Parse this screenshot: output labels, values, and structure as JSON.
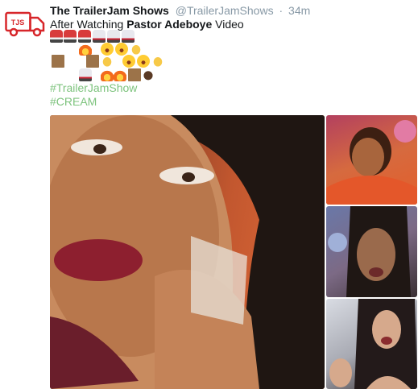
{
  "tweet": {
    "avatar_icon": "trailerjam-truck-logo-icon",
    "avatar_text": "TJS",
    "name": "The TrailerJam Shows",
    "handle": "@TrailerJamShows",
    "separator": "·",
    "time": "34m",
    "text_prefix": "After Watching",
    "text_bold": "Pastor Adeboye",
    "text_suffix": "Video",
    "emoji_rows": [
      [
        "bus-emoji",
        "bus-emoji",
        "bus-emoji",
        "ambulance-emoji",
        "ambulance-emoji",
        "ambulance-emoji"
      ],
      [
        "fire-emoji",
        "laughing-emoji",
        "laughing-emoji",
        "clap-emoji"
      ],
      [
        "brown-square-emoji",
        "brown-square-emoji",
        "clap-emoji",
        "laughing-emoji",
        "laughing-emoji",
        "clap-emoji"
      ],
      [
        "ambulance-emoji",
        "fire-emoji",
        "fire-emoji",
        "brown-square-emoji",
        "dark-hand-emoji"
      ]
    ],
    "hashtags": [
      "#TrailerJamShow",
      "#CREAM"
    ],
    "media": [
      {
        "name": "photo-woman-rolling-eyes"
      },
      {
        "name": "photo-woman-shocked"
      },
      {
        "name": "photo-woman-crying"
      },
      {
        "name": "photo-woman-shocked-hands"
      }
    ],
    "colors": {
      "hashtag": "#7dc37d",
      "meta": "#8899a6",
      "logo": "#d7262a"
    }
  }
}
